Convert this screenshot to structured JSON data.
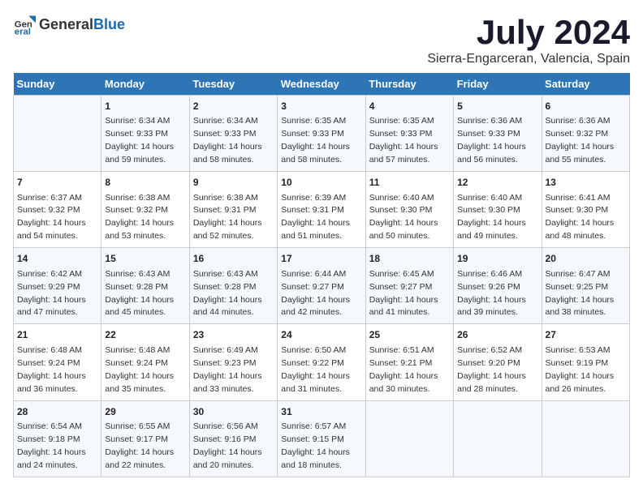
{
  "logo": {
    "text_general": "General",
    "text_blue": "Blue"
  },
  "title": "July 2024",
  "subtitle": "Sierra-Engarceran, Valencia, Spain",
  "days_of_week": [
    "Sunday",
    "Monday",
    "Tuesday",
    "Wednesday",
    "Thursday",
    "Friday",
    "Saturday"
  ],
  "weeks": [
    [
      {
        "day": "",
        "sunrise": "",
        "sunset": "",
        "daylight": ""
      },
      {
        "day": "1",
        "sunrise": "Sunrise: 6:34 AM",
        "sunset": "Sunset: 9:33 PM",
        "daylight": "Daylight: 14 hours and 59 minutes."
      },
      {
        "day": "2",
        "sunrise": "Sunrise: 6:34 AM",
        "sunset": "Sunset: 9:33 PM",
        "daylight": "Daylight: 14 hours and 58 minutes."
      },
      {
        "day": "3",
        "sunrise": "Sunrise: 6:35 AM",
        "sunset": "Sunset: 9:33 PM",
        "daylight": "Daylight: 14 hours and 58 minutes."
      },
      {
        "day": "4",
        "sunrise": "Sunrise: 6:35 AM",
        "sunset": "Sunset: 9:33 PM",
        "daylight": "Daylight: 14 hours and 57 minutes."
      },
      {
        "day": "5",
        "sunrise": "Sunrise: 6:36 AM",
        "sunset": "Sunset: 9:33 PM",
        "daylight": "Daylight: 14 hours and 56 minutes."
      },
      {
        "day": "6",
        "sunrise": "Sunrise: 6:36 AM",
        "sunset": "Sunset: 9:32 PM",
        "daylight": "Daylight: 14 hours and 55 minutes."
      }
    ],
    [
      {
        "day": "7",
        "sunrise": "Sunrise: 6:37 AM",
        "sunset": "Sunset: 9:32 PM",
        "daylight": "Daylight: 14 hours and 54 minutes."
      },
      {
        "day": "8",
        "sunrise": "Sunrise: 6:38 AM",
        "sunset": "Sunset: 9:32 PM",
        "daylight": "Daylight: 14 hours and 53 minutes."
      },
      {
        "day": "9",
        "sunrise": "Sunrise: 6:38 AM",
        "sunset": "Sunset: 9:31 PM",
        "daylight": "Daylight: 14 hours and 52 minutes."
      },
      {
        "day": "10",
        "sunrise": "Sunrise: 6:39 AM",
        "sunset": "Sunset: 9:31 PM",
        "daylight": "Daylight: 14 hours and 51 minutes."
      },
      {
        "day": "11",
        "sunrise": "Sunrise: 6:40 AM",
        "sunset": "Sunset: 9:30 PM",
        "daylight": "Daylight: 14 hours and 50 minutes."
      },
      {
        "day": "12",
        "sunrise": "Sunrise: 6:40 AM",
        "sunset": "Sunset: 9:30 PM",
        "daylight": "Daylight: 14 hours and 49 minutes."
      },
      {
        "day": "13",
        "sunrise": "Sunrise: 6:41 AM",
        "sunset": "Sunset: 9:30 PM",
        "daylight": "Daylight: 14 hours and 48 minutes."
      }
    ],
    [
      {
        "day": "14",
        "sunrise": "Sunrise: 6:42 AM",
        "sunset": "Sunset: 9:29 PM",
        "daylight": "Daylight: 14 hours and 47 minutes."
      },
      {
        "day": "15",
        "sunrise": "Sunrise: 6:43 AM",
        "sunset": "Sunset: 9:28 PM",
        "daylight": "Daylight: 14 hours and 45 minutes."
      },
      {
        "day": "16",
        "sunrise": "Sunrise: 6:43 AM",
        "sunset": "Sunset: 9:28 PM",
        "daylight": "Daylight: 14 hours and 44 minutes."
      },
      {
        "day": "17",
        "sunrise": "Sunrise: 6:44 AM",
        "sunset": "Sunset: 9:27 PM",
        "daylight": "Daylight: 14 hours and 42 minutes."
      },
      {
        "day": "18",
        "sunrise": "Sunrise: 6:45 AM",
        "sunset": "Sunset: 9:27 PM",
        "daylight": "Daylight: 14 hours and 41 minutes."
      },
      {
        "day": "19",
        "sunrise": "Sunrise: 6:46 AM",
        "sunset": "Sunset: 9:26 PM",
        "daylight": "Daylight: 14 hours and 39 minutes."
      },
      {
        "day": "20",
        "sunrise": "Sunrise: 6:47 AM",
        "sunset": "Sunset: 9:25 PM",
        "daylight": "Daylight: 14 hours and 38 minutes."
      }
    ],
    [
      {
        "day": "21",
        "sunrise": "Sunrise: 6:48 AM",
        "sunset": "Sunset: 9:24 PM",
        "daylight": "Daylight: 14 hours and 36 minutes."
      },
      {
        "day": "22",
        "sunrise": "Sunrise: 6:48 AM",
        "sunset": "Sunset: 9:24 PM",
        "daylight": "Daylight: 14 hours and 35 minutes."
      },
      {
        "day": "23",
        "sunrise": "Sunrise: 6:49 AM",
        "sunset": "Sunset: 9:23 PM",
        "daylight": "Daylight: 14 hours and 33 minutes."
      },
      {
        "day": "24",
        "sunrise": "Sunrise: 6:50 AM",
        "sunset": "Sunset: 9:22 PM",
        "daylight": "Daylight: 14 hours and 31 minutes."
      },
      {
        "day": "25",
        "sunrise": "Sunrise: 6:51 AM",
        "sunset": "Sunset: 9:21 PM",
        "daylight": "Daylight: 14 hours and 30 minutes."
      },
      {
        "day": "26",
        "sunrise": "Sunrise: 6:52 AM",
        "sunset": "Sunset: 9:20 PM",
        "daylight": "Daylight: 14 hours and 28 minutes."
      },
      {
        "day": "27",
        "sunrise": "Sunrise: 6:53 AM",
        "sunset": "Sunset: 9:19 PM",
        "daylight": "Daylight: 14 hours and 26 minutes."
      }
    ],
    [
      {
        "day": "28",
        "sunrise": "Sunrise: 6:54 AM",
        "sunset": "Sunset: 9:18 PM",
        "daylight": "Daylight: 14 hours and 24 minutes."
      },
      {
        "day": "29",
        "sunrise": "Sunrise: 6:55 AM",
        "sunset": "Sunset: 9:17 PM",
        "daylight": "Daylight: 14 hours and 22 minutes."
      },
      {
        "day": "30",
        "sunrise": "Sunrise: 6:56 AM",
        "sunset": "Sunset: 9:16 PM",
        "daylight": "Daylight: 14 hours and 20 minutes."
      },
      {
        "day": "31",
        "sunrise": "Sunrise: 6:57 AM",
        "sunset": "Sunset: 9:15 PM",
        "daylight": "Daylight: 14 hours and 18 minutes."
      },
      {
        "day": "",
        "sunrise": "",
        "sunset": "",
        "daylight": ""
      },
      {
        "day": "",
        "sunrise": "",
        "sunset": "",
        "daylight": ""
      },
      {
        "day": "",
        "sunrise": "",
        "sunset": "",
        "daylight": ""
      }
    ]
  ]
}
